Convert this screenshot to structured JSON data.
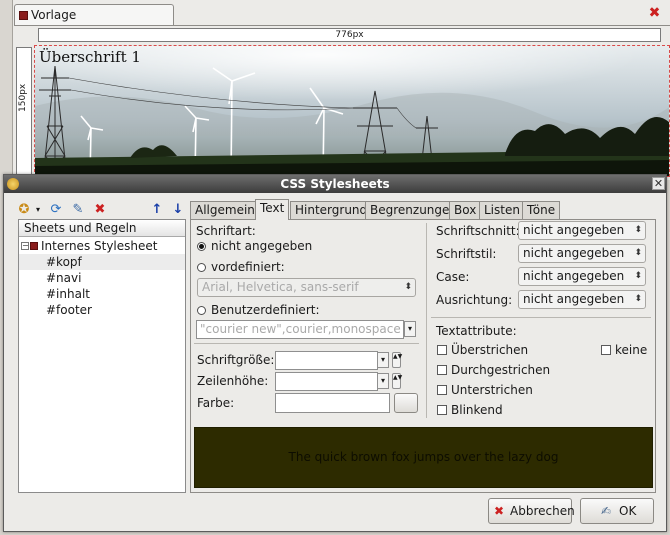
{
  "editor": {
    "doc_tab_label": "Vorlage",
    "ruler_width_label": "776px",
    "ruler_height_label": "150px",
    "header_heading": "Überschrift 1"
  },
  "dialog": {
    "title": "CSS Stylesheets",
    "sheets_header": "Sheets und Regeln",
    "tree": {
      "root": "Internes Stylesheet",
      "rules": [
        "#kopf",
        "#navi",
        "#inhalt",
        "#footer"
      ]
    },
    "tabs": [
      "Allgemein",
      "Text",
      "Hintergrund",
      "Begrenzungen",
      "Box",
      "Listen",
      "Töne"
    ],
    "active_tab": "Text",
    "text_tab": {
      "schriftart_label": "Schriftart:",
      "radio_none": "nicht angegeben",
      "radio_predefined": "vordefiniert:",
      "predefined_value": "Arial, Helvetica, sans-serif",
      "radio_custom": "Benutzerdefiniert:",
      "custom_value": "\"courier new\",courier,monospace",
      "size_label": "Schriftgröße:",
      "lineheight_label": "Zeilenhöhe:",
      "color_label": "Farbe:",
      "style_label": "Schriftschnitt:",
      "style_value": "nicht angegeben",
      "stil_label": "Schriftstil:",
      "stil_value": "nicht angegeben",
      "case_label": "Case:",
      "case_value": "nicht angegeben",
      "align_label": "Ausrichtung:",
      "align_value": "nicht angegeben",
      "attributes_label": "Textattribute:",
      "overline": "Überstrichen",
      "strike": "Durchgestrichen",
      "underline": "Unterstrichen",
      "blink": "Blinkend",
      "none": "keine"
    },
    "preview_text": "The quick brown fox jumps over the lazy dog",
    "cancel_label": "Abbrechen",
    "ok_label": "OK"
  },
  "colors": {
    "preview_bg": "#2d2b00",
    "title_bar": "#4a4a4a",
    "delete_icon": "#cc2121",
    "arrow_icons": "#1a3fa8"
  }
}
